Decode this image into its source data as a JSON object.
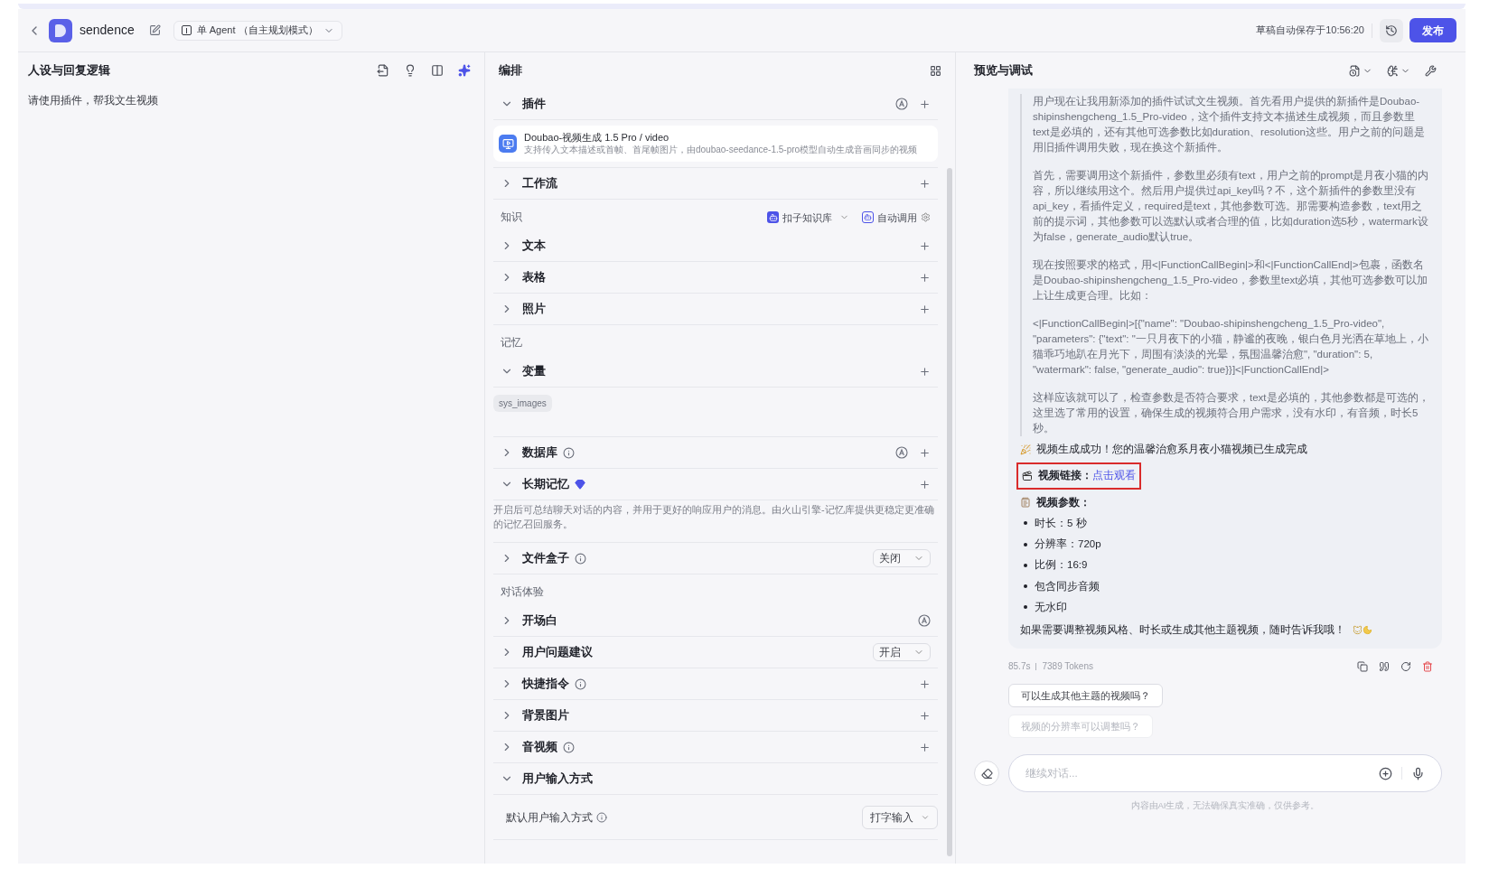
{
  "header": {
    "app_name": "sendence",
    "mode": "单 Agent （自主规划模式）",
    "autosave": "草稿自动保存于10:56:20",
    "publish": "发布"
  },
  "left": {
    "title": "人设与回复逻辑",
    "prompt": "请使用插件，帮我文生视频"
  },
  "middle": {
    "title": "编排",
    "items": [
      {
        "kind": "section",
        "label": "插件",
        "expanded": true,
        "info": false,
        "premium": false,
        "auto": true,
        "add": true
      },
      {
        "kind": "plugin",
        "name": "Doubao-视频生成 1.5 Pro / video",
        "description": "支持传入文本描述或首帧、首尾帧图片，由doubao-seedance-1.5-pro模型自动生成音画同步的视频"
      },
      {
        "kind": "section",
        "label": "工作流",
        "expanded": false,
        "info": false,
        "premium": false,
        "auto": false,
        "add": true
      },
      {
        "kind": "group",
        "label": "知识",
        "source": "扣子知识库",
        "mode": "自动调用"
      },
      {
        "kind": "section",
        "label": "文本",
        "expanded": false,
        "info": false,
        "premium": false,
        "auto": false,
        "add": true
      },
      {
        "kind": "section",
        "label": "表格",
        "expanded": false,
        "info": false,
        "premium": false,
        "auto": false,
        "add": true
      },
      {
        "kind": "section",
        "label": "照片",
        "expanded": false,
        "info": false,
        "premium": false,
        "auto": false,
        "add": true
      },
      {
        "kind": "group",
        "label": "记忆"
      },
      {
        "kind": "section",
        "label": "变量",
        "expanded": true,
        "info": false,
        "premium": false,
        "auto": false,
        "add": true
      },
      {
        "kind": "tag",
        "label": "sys_images"
      },
      {
        "kind": "section",
        "label": "数据库",
        "expanded": false,
        "info": true,
        "premium": false,
        "auto": true,
        "add": true
      },
      {
        "kind": "section",
        "label": "长期记忆",
        "expanded": true,
        "info": false,
        "premium": true,
        "auto": false,
        "add": true
      },
      {
        "kind": "note",
        "text": "开启后可总结聊天对话的内容，并用于更好的响应用户的消息。由火山引擎-记忆库提供更稳定更准确的记忆召回服务。"
      },
      {
        "kind": "section",
        "label": "文件盒子",
        "expanded": false,
        "info": true,
        "premium": false,
        "auto": false,
        "add": false,
        "select": "关闭"
      },
      {
        "kind": "group",
        "label": "对话体验"
      },
      {
        "kind": "section",
        "label": "开场白",
        "expanded": false,
        "info": false,
        "premium": false,
        "auto": true,
        "add": false
      },
      {
        "kind": "section",
        "label": "用户问题建议",
        "expanded": false,
        "info": false,
        "premium": false,
        "auto": false,
        "add": false,
        "select": "开启"
      },
      {
        "kind": "section",
        "label": "快捷指令",
        "expanded": false,
        "info": true,
        "premium": false,
        "auto": false,
        "add": true
      },
      {
        "kind": "section",
        "label": "背景图片",
        "expanded": false,
        "info": false,
        "premium": false,
        "auto": false,
        "add": true
      },
      {
        "kind": "section",
        "label": "音视频",
        "expanded": false,
        "info": true,
        "premium": false,
        "auto": false,
        "add": true
      },
      {
        "kind": "section",
        "label": "用户输入方式",
        "expanded": true,
        "info": false,
        "premium": false,
        "auto": false,
        "add": false
      },
      {
        "kind": "setting",
        "label": "默认用户输入方式",
        "info": true,
        "select": "打字输入"
      }
    ]
  },
  "right": {
    "title": "预览与调试",
    "reasoning": [
      "用户现在让我用新添加的插件试试文生视频。首先看用户提供的新插件是Doubao-shipinshengcheng_1.5_Pro-video，这个插件支持文本描述生成视频，而且参数里text是必填的，还有其他可选参数比如duration、resolution这些。用户之前的问题是用旧插件调用失败，现在换这个新插件。",
      "首先，需要调用这个新插件，参数里必须有text，用户之前的prompt是月夜小猫的内容，所以继续用这个。然后用户提供过api_key吗？不，这个新插件的参数里没有api_key，看插件定义，required是text，其他参数可选。那需要构造参数，text用之前的提示词，其他参数可以选默认或者合理的值，比如duration选5秒，watermark设为false，generate_audio默认true。",
      "现在按照要求的格式，用<|FunctionCallBegin|>和<|FunctionCallEnd|>包裹，函数名是Doubao-shipinshengcheng_1.5_Pro-video，参数里text必填，其他可选参数可以加上让生成更合理。比如：",
      "<|FunctionCallBegin|>[{\"name\": \"Doubao-shipinshengcheng_1.5_Pro-video\", \"parameters\": {\"text\": \"一只月夜下的小猫，静谧的夜晚，银白色月光洒在草地上，小猫乖巧地趴在月光下，周围有淡淡的光晕，氛围温馨治愈\", \"duration\": 5, \"watermark\": false, \"generate_audio\": true}}]<|FunctionCallEnd|>",
      "这样应该就可以了，检查参数是否符合要求，text是必填的，其他参数都是可选的，这里选了常用的设置，确保生成的视频符合用户需求，没有水印，有音频，时长5秒。"
    ],
    "success": "视频生成成功！您的温馨治愈系月夜小猫视频已生成完成",
    "video_link": {
      "label": "视频链接：",
      "link": "点击观看",
      "highlighted": true
    },
    "params_title": "视频参数：",
    "params": [
      "时长：5 秒",
      "分辨率：720p",
      "比例：16:9",
      "包含同步音频",
      "无水印"
    ],
    "closing": "如果需要调整视频风格、时长或生成其他主题视频，随时告诉我哦！",
    "duration": "85.7s",
    "tokens": "7389 Tokens",
    "suggestions": [
      {
        "text": "可以生成其他主题的视频吗？",
        "faded": false
      },
      {
        "text": "视频的分辨率可以调整吗？",
        "faded": true
      }
    ],
    "input_placeholder": "继续对话...",
    "disclaimer": "内容由AI生成，无法确保真实准确，仅供参考。"
  }
}
